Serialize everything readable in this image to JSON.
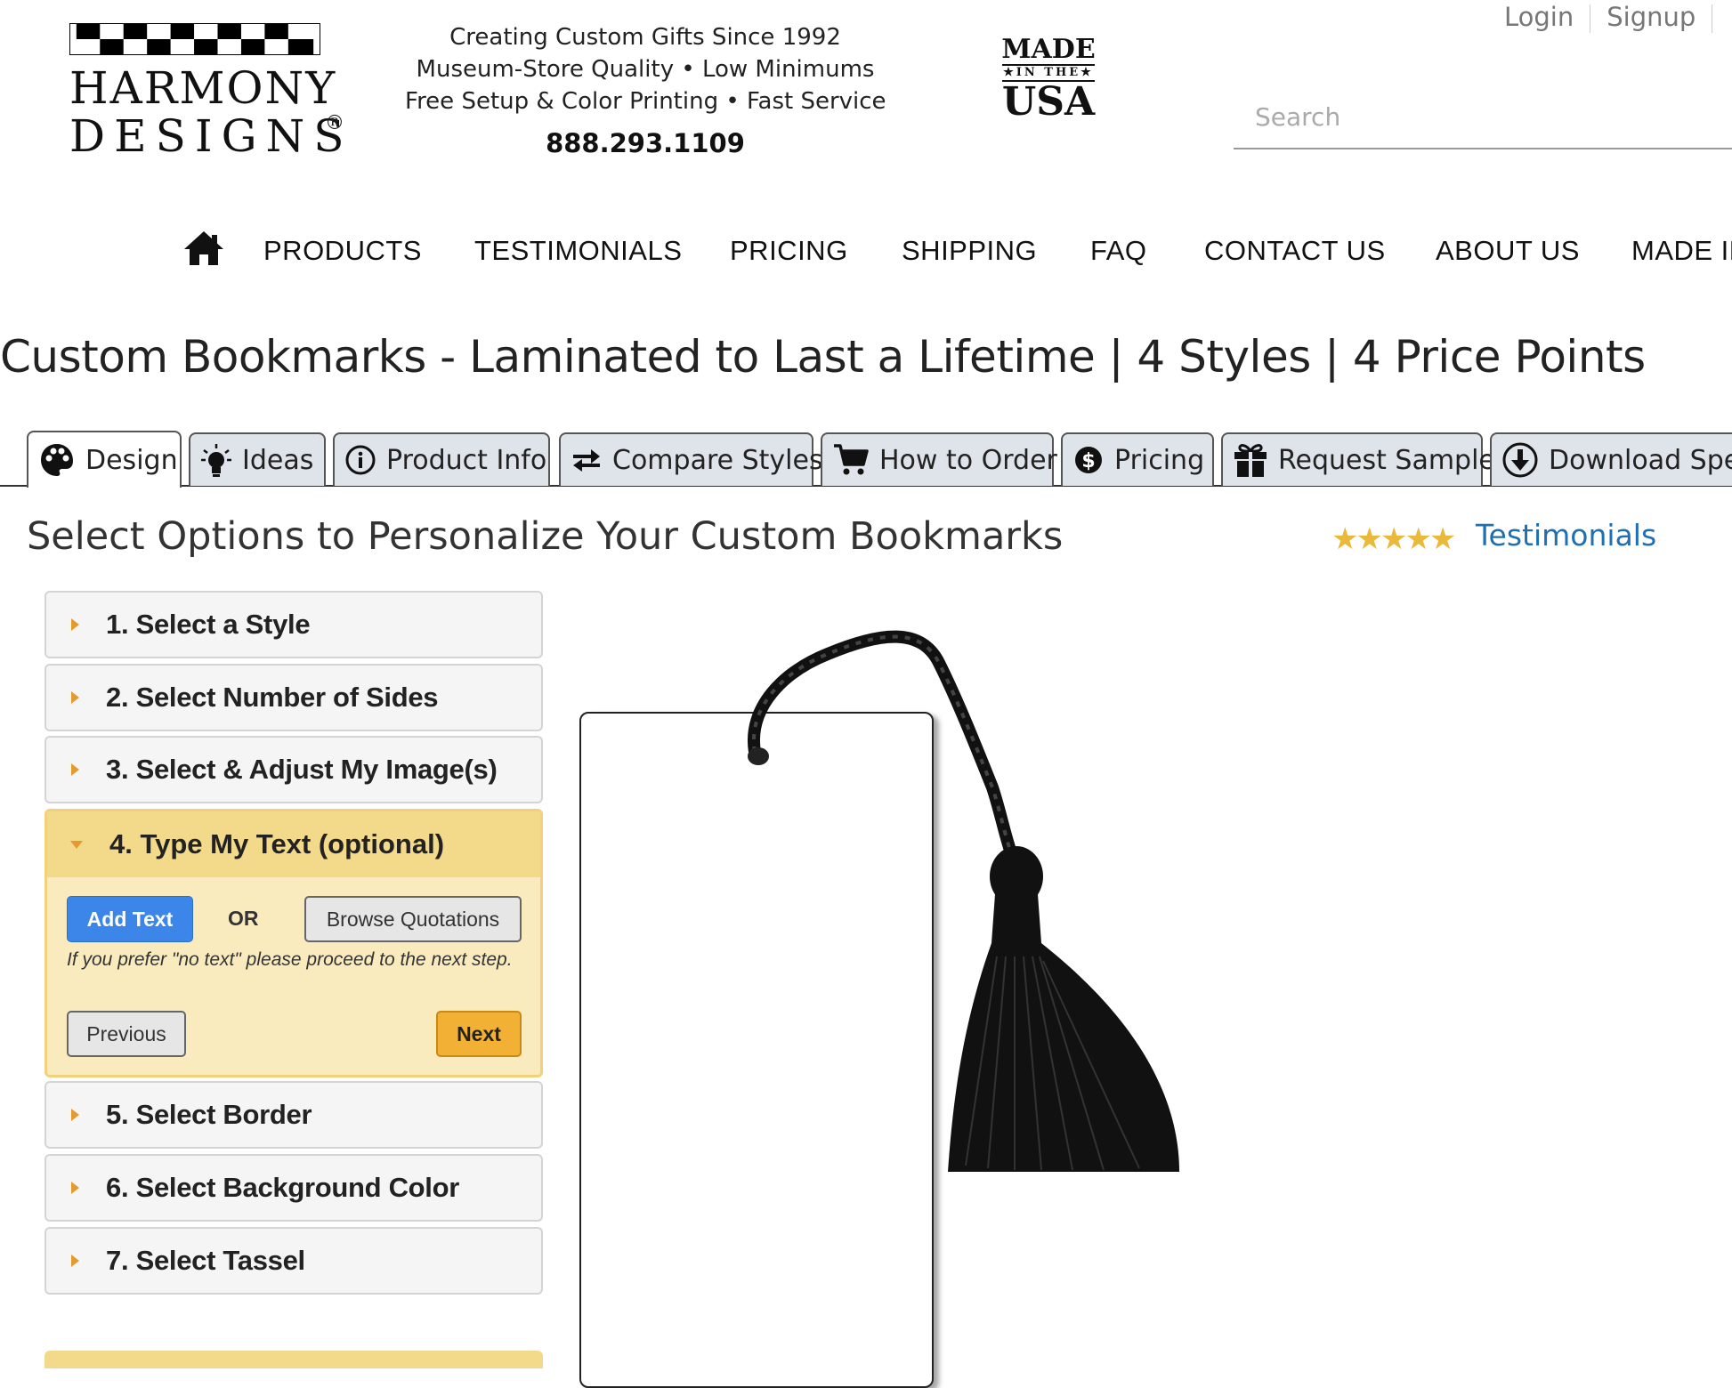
{
  "brand": {
    "logo_line1": "HARMONY",
    "logo_line2": "DESIGNS",
    "registered": "®"
  },
  "header": {
    "tagline": [
      "Creating Custom Gifts Since 1992",
      "Museum-Store Quality • Low Minimums",
      "Free Setup & Color Printing • Fast Service"
    ],
    "phone": "888.293.1109",
    "made_in_usa": {
      "line1": "MADE",
      "line2": "★IN THE★",
      "line3": "USA"
    },
    "login": "Login",
    "signup": "Signup",
    "search_placeholder": "Search"
  },
  "nav": {
    "home_icon": "home-icon",
    "items": [
      "PRODUCTS",
      "TESTIMONIALS",
      "PRICING",
      "SHIPPING",
      "FAQ",
      "CONTACT US",
      "ABOUT US",
      "MADE IN"
    ]
  },
  "page_title": "Custom Bookmarks - Laminated to Last a Lifetime | 4 Styles | 4 Price Points",
  "tabs": [
    {
      "label": "Design",
      "icon": "palette-icon",
      "active": true
    },
    {
      "label": "Ideas",
      "icon": "lightbulb-icon"
    },
    {
      "label": "Product Info",
      "icon": "info-icon"
    },
    {
      "label": "Compare Styles",
      "icon": "compare-arrows-icon"
    },
    {
      "label": "How to Order",
      "icon": "cart-icon"
    },
    {
      "label": "Pricing",
      "icon": "dollar-icon"
    },
    {
      "label": "Request Sample",
      "icon": "gift-icon"
    },
    {
      "label": "Download Specs",
      "icon": "download-icon"
    }
  ],
  "section": {
    "title": "Select Options to Personalize Your Custom Bookmarks",
    "stars": "★★★★★",
    "testimonials_link": "Testimonials"
  },
  "steps": [
    {
      "label": "1. Select a Style"
    },
    {
      "label": "2. Select Number of Sides"
    },
    {
      "label": "3. Select & Adjust My Image(s)"
    },
    {
      "label": "4. Type My Text (optional)",
      "open": true
    },
    {
      "label": "5. Select Border"
    },
    {
      "label": "6. Select Background Color"
    },
    {
      "label": "7. Select Tassel"
    }
  ],
  "step4": {
    "add_text": "Add Text",
    "or": "OR",
    "browse_quotations": "Browse Quotations",
    "hint": "If you prefer \"no text\" please proceed to the next step.",
    "previous": "Previous",
    "next": "Next"
  },
  "colors": {
    "accent_blue": "#3b86e8",
    "accent_orange": "#f2b135",
    "open_step_bg": "#faebbf",
    "link": "#1f6fb2"
  }
}
